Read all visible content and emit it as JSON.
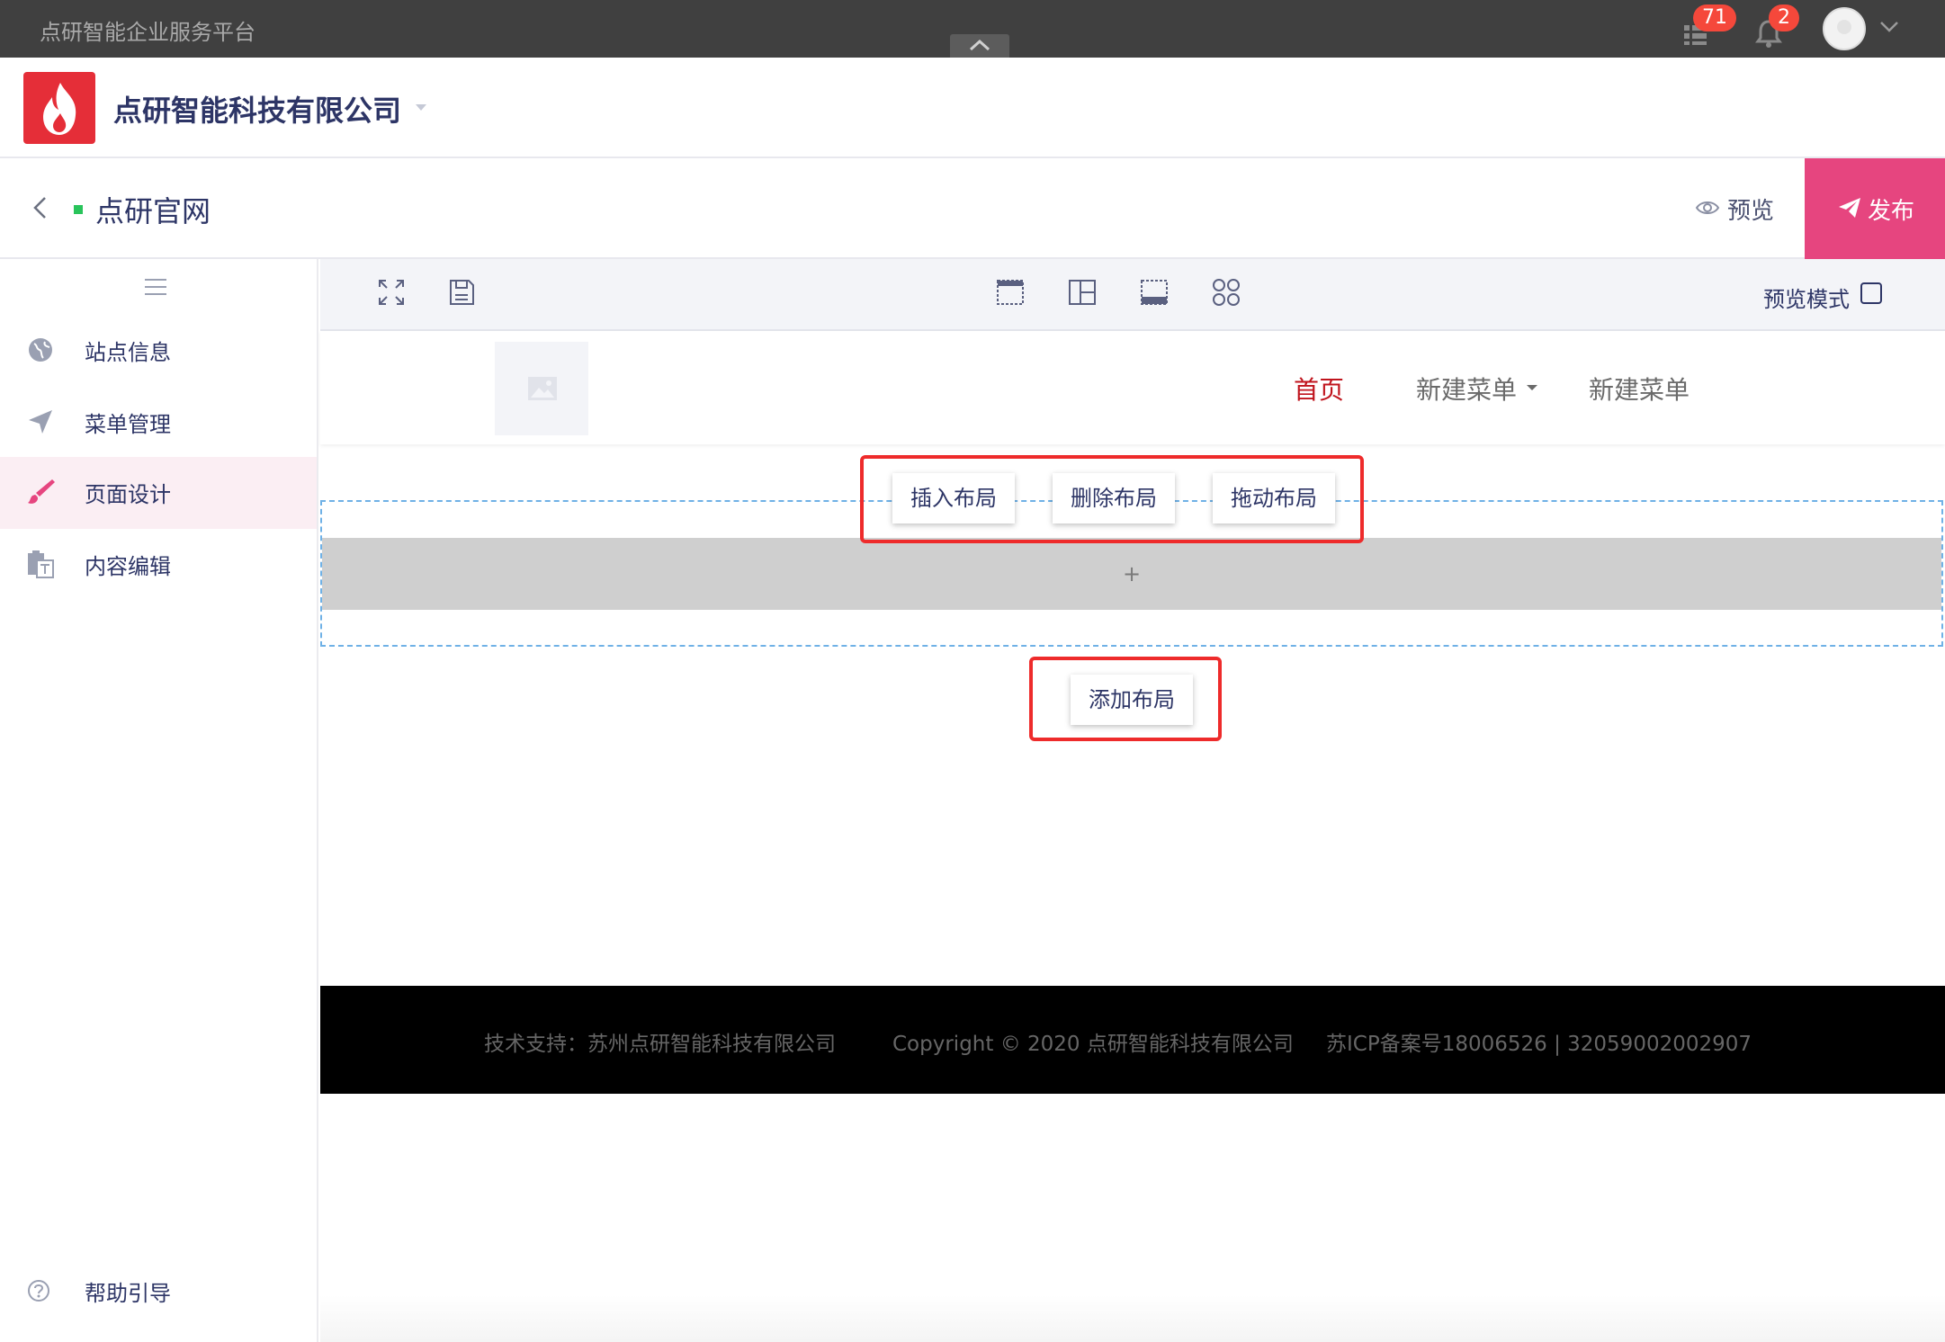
{
  "topbar": {
    "platform_title": "点研智能企业服务平台",
    "tasks_count": "71",
    "notifications_count": "2"
  },
  "company": {
    "name": "点研智能科技有限公司"
  },
  "site": {
    "name": "点研官网",
    "preview_label": "预览",
    "publish_label": "发布"
  },
  "sidebar": {
    "items": [
      {
        "label": "站点信息",
        "icon": "globe-icon"
      },
      {
        "label": "菜单管理",
        "icon": "paper-plane-icon"
      },
      {
        "label": "页面设计",
        "icon": "brush-icon",
        "active": true
      },
      {
        "label": "内容编辑",
        "icon": "clipboard-text-icon"
      }
    ],
    "help_label": "帮助引导"
  },
  "toolbar": {
    "preview_mode_label": "预览模式",
    "preview_mode_checked": false
  },
  "canvas": {
    "nav": [
      "首页",
      "新建菜单",
      "新建菜单"
    ],
    "layout_actions": [
      "插入布局",
      "删除布局",
      "拖动布局"
    ],
    "plus_symbol": "+",
    "add_layout_label": "添加布局"
  },
  "footer": {
    "support": "技术支持：苏州点研智能科技有限公司",
    "copyright": "Copyright © 2020 点研智能科技有限公司",
    "icp": "苏ICP备案号18006526 | 32059002002907"
  },
  "colors": {
    "topbar": "#404040",
    "publish": "#e6457f",
    "active_nav": "#c0141d",
    "highlight": "#ee2b2b",
    "badge": "#f5483b"
  }
}
